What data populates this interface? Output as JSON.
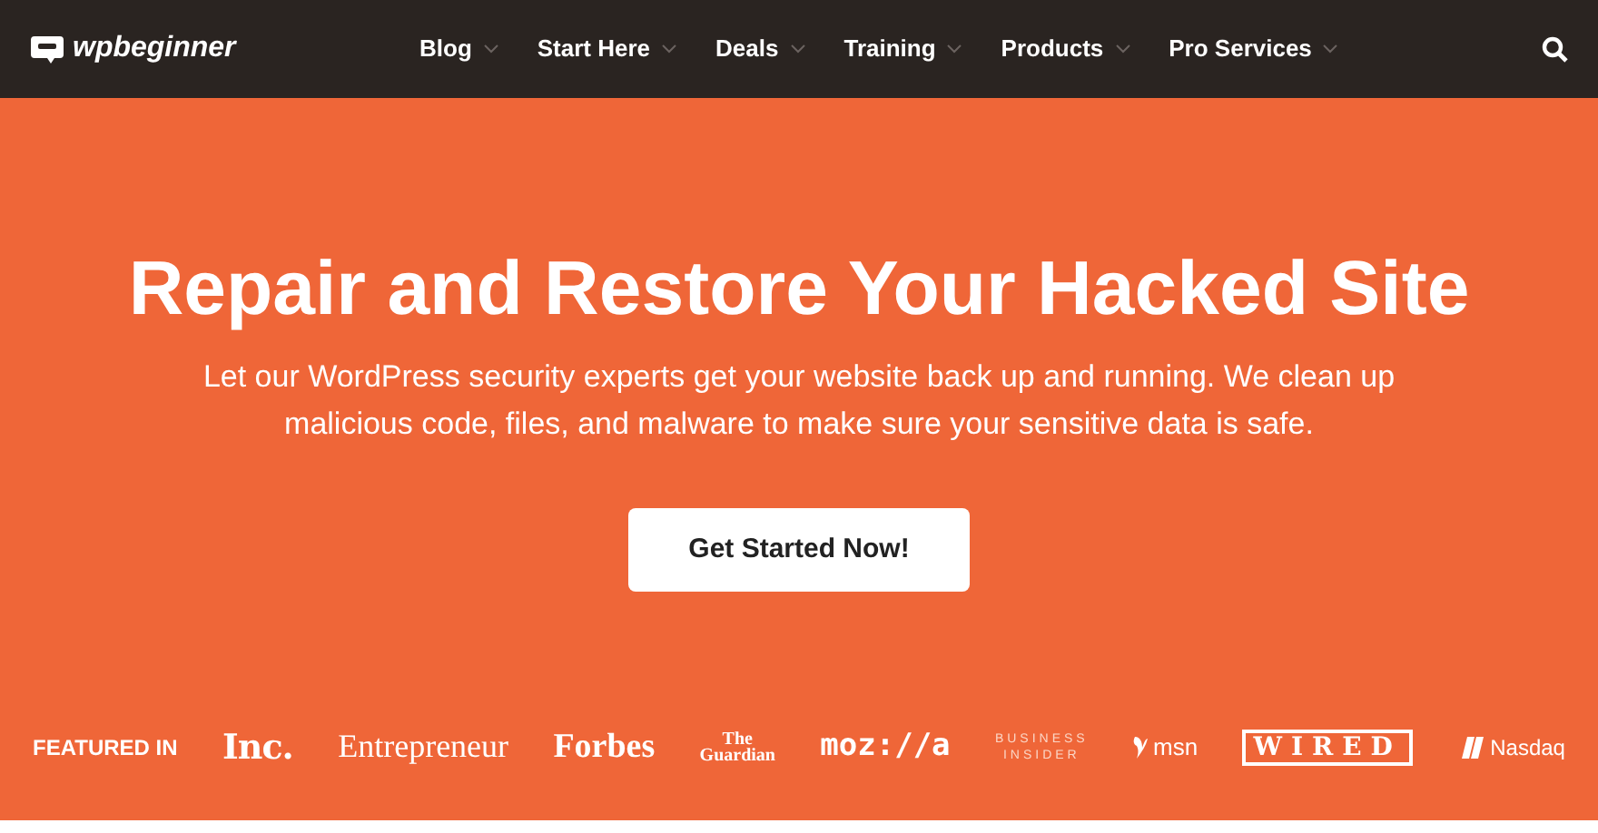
{
  "header": {
    "logo": "wpbeginner",
    "nav": [
      {
        "label": "Blog",
        "dropdown": true
      },
      {
        "label": "Start Here",
        "dropdown": true
      },
      {
        "label": "Deals",
        "dropdown": true
      },
      {
        "label": "Training",
        "dropdown": true
      },
      {
        "label": "Products",
        "dropdown": true
      },
      {
        "label": "Pro Services",
        "dropdown": true
      }
    ]
  },
  "hero": {
    "title": "Repair and Restore Your Hacked Site",
    "text": "Let our WordPress security experts get your website back up and running. We clean up malicious code, files, and malware to make sure your sensitive data is safe.",
    "button": "Get Started Now!"
  },
  "featured": {
    "label": "FEATURED IN",
    "logos": [
      {
        "kind": "heavy",
        "lines": [
          "Inc."
        ]
      },
      {
        "kind": "serif",
        "lines": [
          "Entrepreneur"
        ]
      },
      {
        "kind": "serif-bold",
        "lines": [
          "Forbes"
        ]
      },
      {
        "kind": "stacked",
        "lines": [
          "The",
          "Guardian"
        ]
      },
      {
        "kind": "mono",
        "lines": [
          "moz://a"
        ]
      },
      {
        "kind": "spaced",
        "lines": [
          "BUSINESS",
          "INSIDER"
        ]
      },
      {
        "kind": "msn",
        "lines": [
          "msn"
        ]
      },
      {
        "kind": "wired",
        "lines": [
          "WIRED"
        ]
      },
      {
        "kind": "nasdaq",
        "lines": [
          "Nasdaq"
        ]
      }
    ]
  }
}
